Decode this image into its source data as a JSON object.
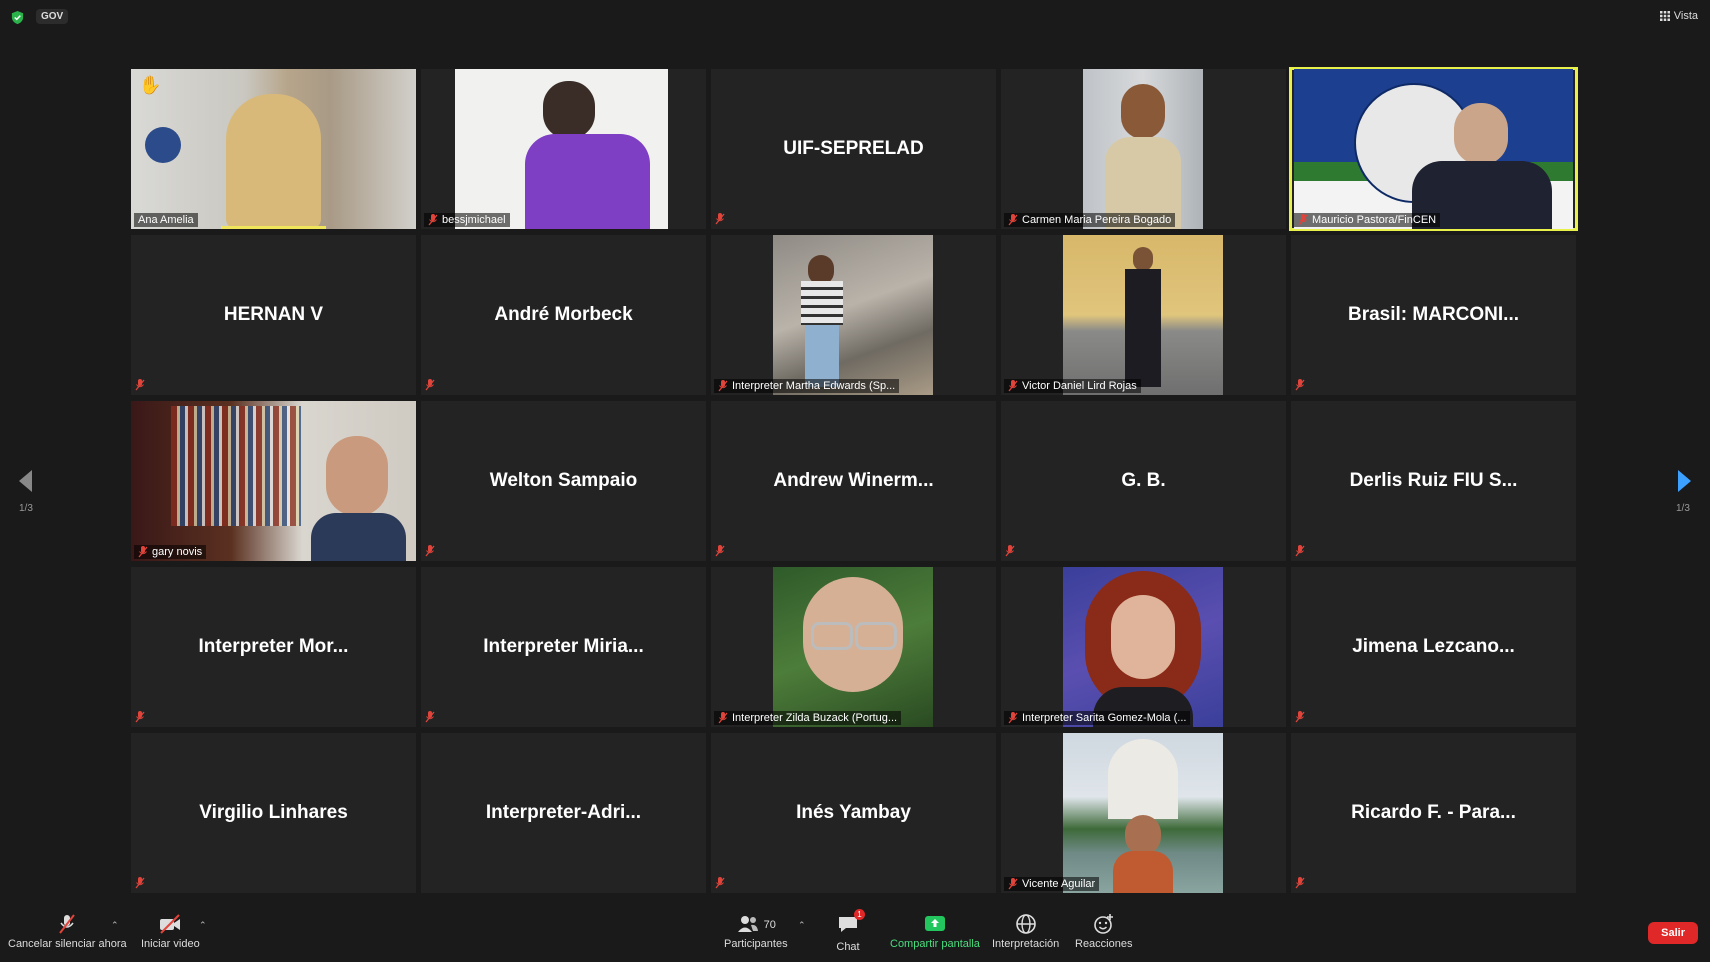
{
  "topbar": {
    "gov_label": "GOV",
    "view_label": "Vista"
  },
  "tiles": [
    {
      "name": "Ana Amelia",
      "video": true
    },
    {
      "name": "bessjmichael",
      "video": true
    },
    {
      "name": "UIF-SEPRELAD",
      "video": false
    },
    {
      "name": "Carmen Maria Pereira Bogado",
      "video": true
    },
    {
      "name": "Mauricio Pastora/FinCEN",
      "video": true,
      "active_speaker": true
    },
    {
      "name": "HERNAN V",
      "video": false
    },
    {
      "name": "André Morbeck",
      "video": false
    },
    {
      "name": "Interpreter Martha Edwards (Sp...",
      "video": true
    },
    {
      "name": "Victor Daniel Lird Rojas",
      "video": true
    },
    {
      "name": "Brasil:  MARCONI...",
      "video": false
    },
    {
      "name": "gary novis",
      "video": true
    },
    {
      "name": "Welton  Sampaio",
      "video": false
    },
    {
      "name": "Andrew  Winerm...",
      "video": false
    },
    {
      "name": "G. B.",
      "video": false
    },
    {
      "name": "Derlis Ruiz FIU S...",
      "video": false
    },
    {
      "name": "Interpreter  Mor...",
      "video": false
    },
    {
      "name": "Interpreter  Miria...",
      "video": false
    },
    {
      "name": "Interpreter Zilda Buzack (Portug...",
      "video": true
    },
    {
      "name": "Interpreter Sarita Gomez-Mola (...",
      "video": true
    },
    {
      "name": "Jimena  Lezcano...",
      "video": false
    },
    {
      "name": "Virgilio Linhares",
      "video": false
    },
    {
      "name": "Interpreter-Adri...",
      "video": false
    },
    {
      "name": "Inés Yambay",
      "video": false
    },
    {
      "name": "Vicente Aguilar",
      "video": true
    },
    {
      "name": "Ricardo F. - Para...",
      "video": false
    }
  ],
  "pagination": {
    "left": "1/3",
    "right": "1/3"
  },
  "toolbar": {
    "unmute_label": "Cancelar silenciar ahora",
    "video_label": "Iniciar video",
    "participants_label": "Participantes",
    "participants_count": "70",
    "chat_label": "Chat",
    "chat_badge": "1",
    "share_label": "Compartir pantalla",
    "interpretation_label": "Interpretación",
    "reactions_label": "Reacciones",
    "leave_label": "Salir"
  },
  "colors": {
    "active_border": "#e8f04a",
    "share_green": "#22c55e",
    "leave_red": "#e02828",
    "next_arrow": "#3ba0ff",
    "mic_muted": "#e0443b"
  }
}
